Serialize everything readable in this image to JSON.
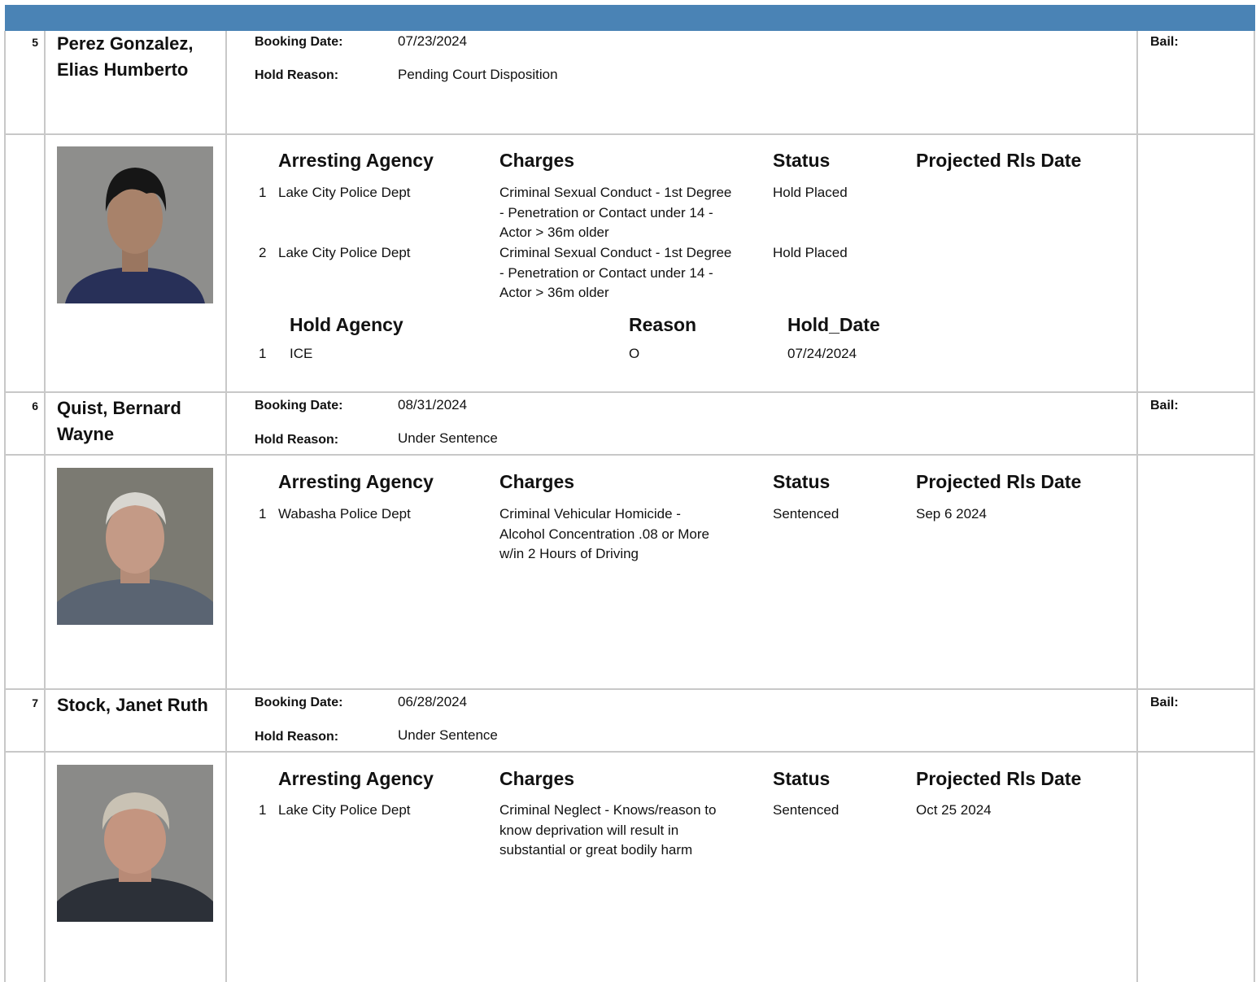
{
  "inmates": [
    {
      "number": "5",
      "name": "Perez Gonzalez, Elias Humberto",
      "booking_label": "Booking Date:",
      "booking_date": "07/23/2024",
      "hold_reason_label": "Hold Reason:",
      "hold_reason": "Pending Court Disposition",
      "bail_label": "Bail:",
      "photo": {
        "bg": "#8e8e8c",
        "hair": "#161616",
        "skin": "#a8826a",
        "shirt": "#283058",
        "description": "mugshot-young-man"
      },
      "charges_headers": {
        "agency": "Arresting Agency",
        "charges": "Charges",
        "status": "Status",
        "release": "Projected Rls Date"
      },
      "charges": [
        {
          "n": "1",
          "agency": "Lake City Police Dept",
          "charge": "Criminal Sexual Conduct - 1st Degree - Penetration or Contact under 14 - Actor > 36m older",
          "status": "Hold Placed",
          "release": ""
        },
        {
          "n": "2",
          "agency": "Lake City Police Dept",
          "charge": "Criminal Sexual Conduct - 1st Degree - Penetration or Contact under 14 - Actor > 36m older",
          "status": "Hold Placed",
          "release": ""
        }
      ],
      "holds_headers": {
        "agency": "Hold Agency",
        "reason": "Reason",
        "date": "Hold_Date"
      },
      "holds": [
        {
          "n": "1",
          "agency": "ICE",
          "reason": "O",
          "date": "07/24/2024"
        }
      ]
    },
    {
      "number": "6",
      "name": "Quist, Bernard Wayne",
      "booking_label": "Booking Date:",
      "booking_date": "08/31/2024",
      "hold_reason_label": "Hold Reason:",
      "hold_reason": "Under Sentence",
      "bail_label": "Bail:",
      "photo": {
        "bg": "#7b7a72",
        "hair": "#d8d6d0",
        "skin": "#c49a86",
        "shirt": "#5a6472",
        "description": "mugshot-elderly-man"
      },
      "charges_headers": {
        "agency": "Arresting Agency",
        "charges": "Charges",
        "status": "Status",
        "release": "Projected Rls Date"
      },
      "charges": [
        {
          "n": "1",
          "agency": "Wabasha Police Dept",
          "charge": "Criminal Vehicular Homicide - Alcohol Concentration .08 or More w/in 2 Hours of Driving",
          "status": "Sentenced",
          "release": "Sep 6 2024"
        }
      ]
    },
    {
      "number": "7",
      "name": "Stock, Janet Ruth",
      "booking_label": "Booking Date:",
      "booking_date": "06/28/2024",
      "hold_reason_label": "Hold Reason:",
      "hold_reason": "Under Sentence",
      "bail_label": "Bail:",
      "photo": {
        "bg": "#8a8a88",
        "hair": "#c9c2b4",
        "skin": "#c49580",
        "shirt": "#2c3038",
        "description": "mugshot-woman"
      },
      "charges_headers": {
        "agency": "Arresting Agency",
        "charges": "Charges",
        "status": "Status",
        "release": "Projected Rls Date"
      },
      "charges": [
        {
          "n": "1",
          "agency": "Lake City Police Dept",
          "charge": "Criminal Neglect - Knows/reason to know deprivation will result in substantial or great bodily harm",
          "status": "Sentenced",
          "release": "Oct 25 2024"
        }
      ]
    }
  ],
  "colors": {
    "header_bar": "#4a83b5",
    "grid": "#c8c8c8"
  }
}
